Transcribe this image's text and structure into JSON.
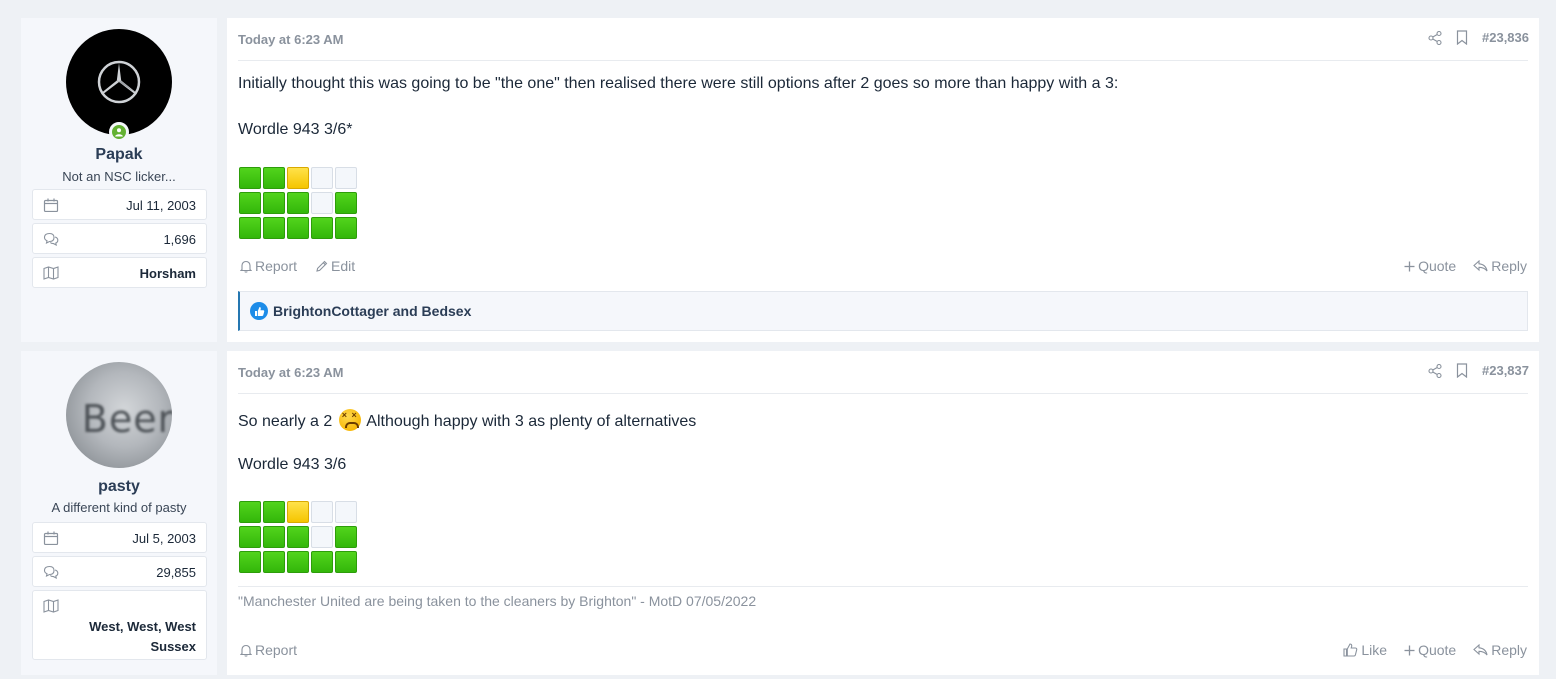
{
  "posts": [
    {
      "user": {
        "name": "Papak",
        "title": "Not an NSC licker...",
        "joined": "Jul 11, 2003",
        "messages": "1,696",
        "location": "Horsham",
        "avatar_icon": "mercedes-logo-icon",
        "online": true
      },
      "time": "Today at 6:23 AM",
      "number": "#23,836",
      "lines": [
        "Initially thought this was going to be \"the one\" then realised there were still options after 2 goes so more than happy with a 3:",
        "Wordle 943 3/6*"
      ],
      "wordle_rows": [
        [
          "g",
          "g",
          "y",
          "w",
          "w"
        ],
        [
          "g",
          "g",
          "g",
          "w",
          "g"
        ],
        [
          "g",
          "g",
          "g",
          "g",
          "g"
        ]
      ],
      "actions_left": [
        "Report",
        "Edit"
      ],
      "actions_right": [
        "Quote",
        "Reply"
      ],
      "reactions": "BrightonCottager and Bedsex"
    },
    {
      "user": {
        "name": "pasty",
        "title": "A different kind of pasty",
        "joined": "Jul 5, 2003",
        "messages": "29,855",
        "location_line1": "West, West, West",
        "location_line2": "Sussex",
        "avatar_text": "Beer",
        "online": false
      },
      "time": "Today at 6:23 AM",
      "number": "#23,837",
      "line1_before": "So nearly a 2",
      "line1_after": "Although happy with 3 as plenty of alternatives",
      "line2": "Wordle 943 3/6",
      "wordle_rows": [
        [
          "g",
          "g",
          "y",
          "w",
          "w"
        ],
        [
          "g",
          "g",
          "g",
          "w",
          "g"
        ],
        [
          "g",
          "g",
          "g",
          "g",
          "g"
        ]
      ],
      "signature": "\"Manchester United are being taken to the cleaners by Brighton\" - MotD 07/05/2022",
      "actions_left": [
        "Report"
      ],
      "actions_right": [
        "Like",
        "Quote",
        "Reply"
      ]
    }
  ],
  "colors": {
    "green": "#33b70a",
    "yellow": "#f5c500",
    "accent": "#2577b1",
    "online": "#63b132"
  }
}
